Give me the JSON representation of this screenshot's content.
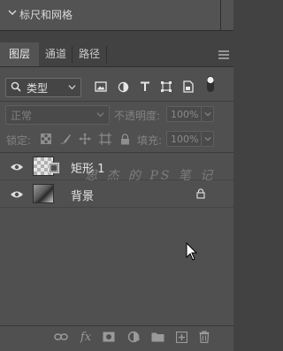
{
  "top_panel": {
    "title": "标尺和网格"
  },
  "tabs": [
    {
      "label": "图层",
      "active": true
    },
    {
      "label": "通道",
      "active": false
    },
    {
      "label": "路径",
      "active": false
    }
  ],
  "filter": {
    "kind_label": "类型",
    "icons": [
      "image-filter-icon",
      "adjustment-filter-icon",
      "type-filter-icon",
      "shape-filter-icon",
      "smart-object-filter-icon",
      "filter-toggle-icon"
    ]
  },
  "blend": {
    "mode": "正常",
    "opacity_label": "不透明度:",
    "opacity_value": "100%"
  },
  "lock": {
    "label": "锁定:",
    "fill_label": "填充:",
    "fill_value": "100%"
  },
  "layers": [
    {
      "name": "矩形 1",
      "visible": true,
      "locked": false
    },
    {
      "name": "背景",
      "visible": true,
      "locked": true
    }
  ],
  "watermark": "思 杰 的 PS 笔 记",
  "bottom_icons": [
    "link-layers-icon",
    "fx-icon",
    "mask-icon",
    "adjustment-layer-icon",
    "group-folder-icon",
    "new-layer-icon",
    "delete-icon"
  ],
  "colors": {
    "panel": "#505050",
    "background": "#424242",
    "text": "#e6e6e6"
  }
}
